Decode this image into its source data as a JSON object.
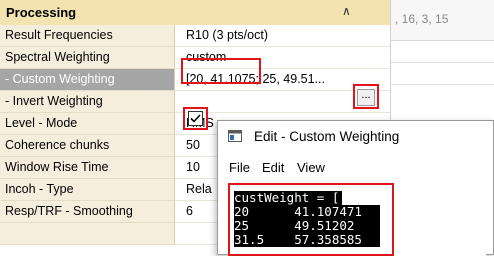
{
  "properties": {
    "header": "Processing",
    "rows": [
      {
        "label": "Result Frequencies",
        "value": "R10 (3 pts/oct)"
      },
      {
        "label": "Spectral Weighting",
        "value": "custom"
      },
      {
        "label": " - Custom Weighting",
        "value": "[20, 41.1075; 25, 49.51..."
      },
      {
        "label": " - Invert Weighting",
        "value": ""
      },
      {
        "label": "Level - Mode",
        "value": "RMS"
      },
      {
        "label": "Coherence chunks",
        "value": "50"
      },
      {
        "label": "Window Rise Time",
        "value": "10"
      },
      {
        "label": "Incoh - Type",
        "value": "Rela"
      },
      {
        "label": "Resp/TRF - Smoothing",
        "value": "6"
      }
    ],
    "ellipsis_label": "...",
    "invert_checked": true
  },
  "right_panel": {
    "text": ", 16, 3, 15"
  },
  "dialog": {
    "title": "Edit  - Custom Weighting",
    "menu": {
      "file": "File",
      "edit": "Edit",
      "view": "View"
    },
    "lines": [
      {
        "text": "custWeight = ["
      },
      {
        "text": "20      41.107471"
      },
      {
        "text": "25      49.51202"
      },
      {
        "text": "31.5    57.358585"
      }
    ]
  },
  "colors": {
    "highlight": "#e0151b",
    "header": "#f3e3b1",
    "selected_row": "#a6a6a6"
  }
}
